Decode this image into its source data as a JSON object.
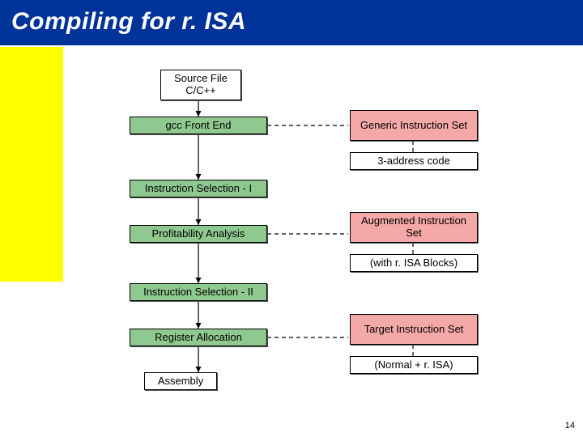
{
  "title": "Compiling for r. ISA",
  "page_number": "14",
  "left": {
    "source": "Source File\nC/C++",
    "gcc": "gcc Front End",
    "isel1": "Instruction Selection - I",
    "profit": "Profitability Analysis",
    "isel2": "Instruction Selection - II",
    "regalloc": "Register Allocation",
    "assembly": "Assembly"
  },
  "right": {
    "generic_iset": "Generic Instruction Set",
    "three_addr": "3-address code",
    "augmented": "Augmented Instruction Set",
    "with_risa": "(with r. ISA Blocks)",
    "target_iset": "Target Instruction Set",
    "normal_risa": "(Normal + r. ISA)"
  }
}
